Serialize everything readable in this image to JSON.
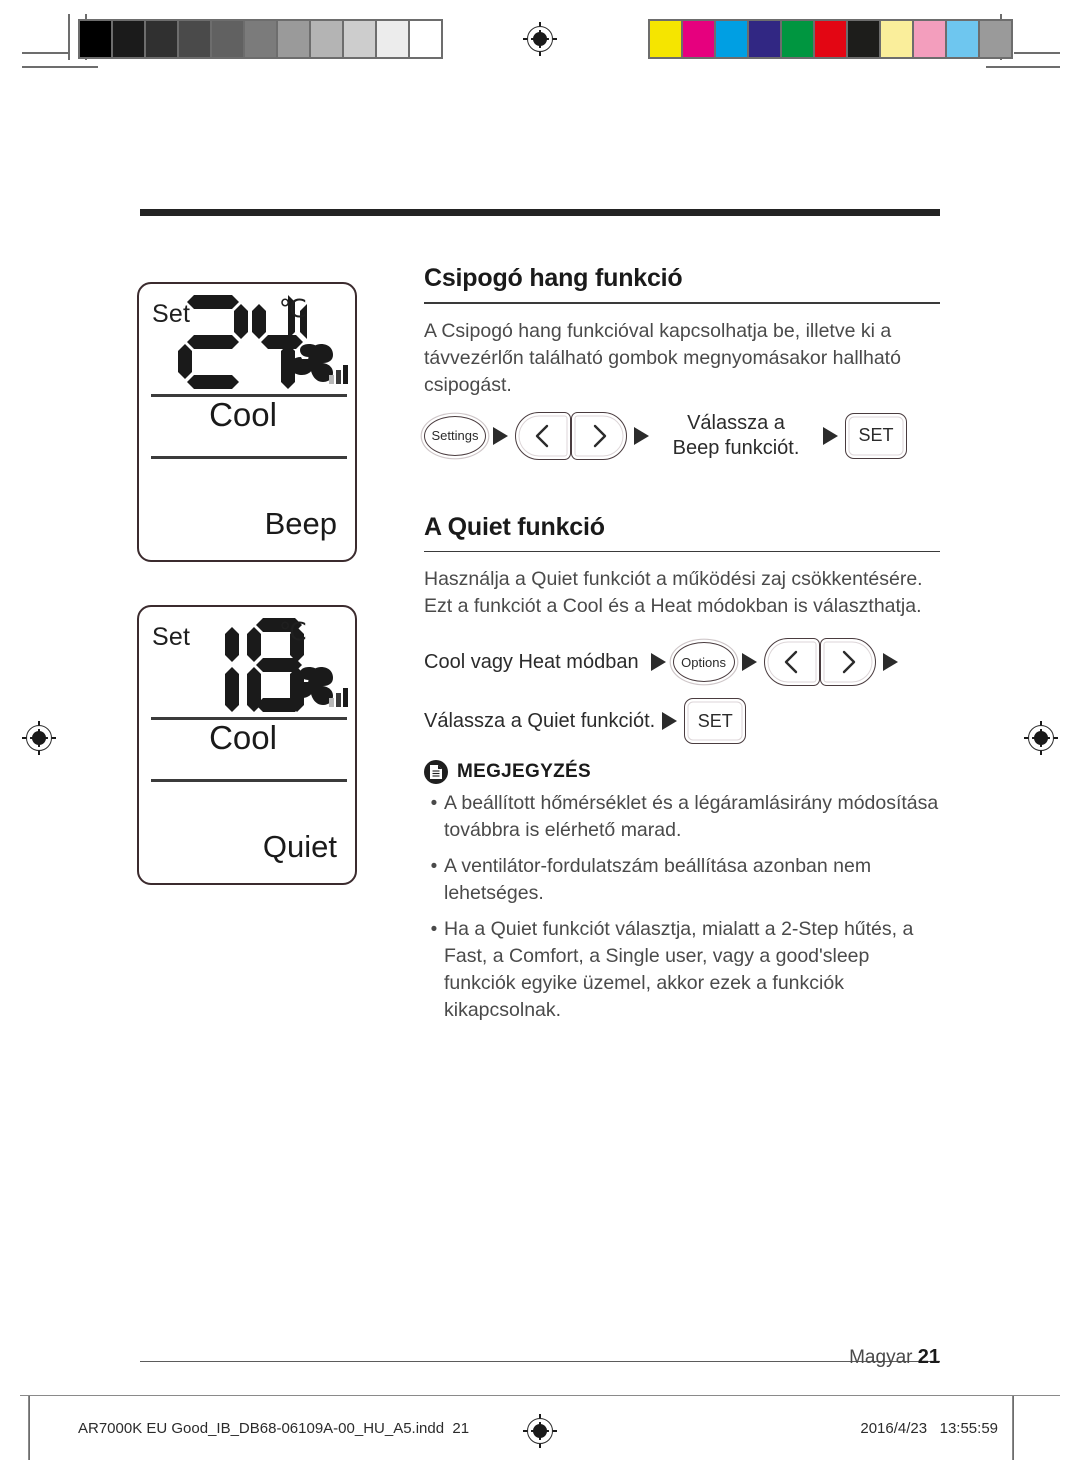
{
  "print_marks": {
    "grayscale_patches": [
      "#000000",
      "#1b1b1b",
      "#303030",
      "#4a4a4a",
      "#616161",
      "#7b7b7b",
      "#9a9a9a",
      "#b4b4b4",
      "#cdcdcd",
      "#ececec",
      "#ffffff"
    ],
    "color_patches": [
      "#f5e500",
      "#e6007e",
      "#009fe3",
      "#312783",
      "#009640",
      "#e30613",
      "#1d1d1b",
      "#faee9b",
      "#f39ebd",
      "#6ec6ef",
      "#9a9a9a"
    ],
    "registration_mark": "registration-target"
  },
  "displays": [
    {
      "id": "beep",
      "set_label": "Set",
      "temperature": "24",
      "unit": "℃",
      "mode": "Cool",
      "feature": "Beep",
      "fan_icon": "fan-pinwheel-icon",
      "fan_bars": 3
    },
    {
      "id": "quiet",
      "set_label": "Set",
      "temperature": "18",
      "unit": "℃",
      "mode": "Cool",
      "feature": "Quiet",
      "fan_icon": "fan-pinwheel-icon",
      "fan_bars": 3
    }
  ],
  "sections": [
    {
      "title": "Csipogó hang funkció",
      "body": "A Csipogó hang funkcióval kapcsolhatja be, illetve ki a távvezérlőn található gombok megnyomásakor hallható csipogást.",
      "steps": {
        "settings_button": "Settings",
        "prev_button": "‹",
        "next_button": "›",
        "instruction": "Válassza a Beep funkciót.",
        "set_button": "SET"
      }
    },
    {
      "title": "A Quiet funkció",
      "body": "Használja a Quiet funkciót a működési zaj csökkentésére. Ezt a funkciót a Cool és a Heat módokban is választhatja.",
      "steps": {
        "mode_label": "Cool vagy Heat módban",
        "options_button": "Options",
        "prev_button": "‹",
        "next_button": "›",
        "instruction": "Válassza a Quiet funkciót.",
        "set_button": "SET"
      }
    }
  ],
  "note": {
    "icon": "note-document-icon",
    "title": "MEGJEGYZÉS",
    "bullet": "•",
    "items": [
      "A beállított hőmérséklet és a légáramlásirány módosítása továbbra is elérhető marad.",
      "A ventilátor-fordulatszám beállítása azonban nem lehetséges.",
      "Ha a Quiet funkciót választja, mialatt a 2-Step hűtés, a Fast, a Comfort, a Single user, vagy a good'sleep funkciók egyike üzemel, akkor ezek a funkciók kikapcsolnak."
    ]
  },
  "page_footer": {
    "language": "Magyar",
    "page_number": "21"
  },
  "print_footer": {
    "filename": "AR7000K EU Good_IB_DB68-06109A-00_HU_A5.indd",
    "page": "21",
    "date": "2016/4/23",
    "time": "13:55:59",
    "registration_mark": "registration-target"
  }
}
